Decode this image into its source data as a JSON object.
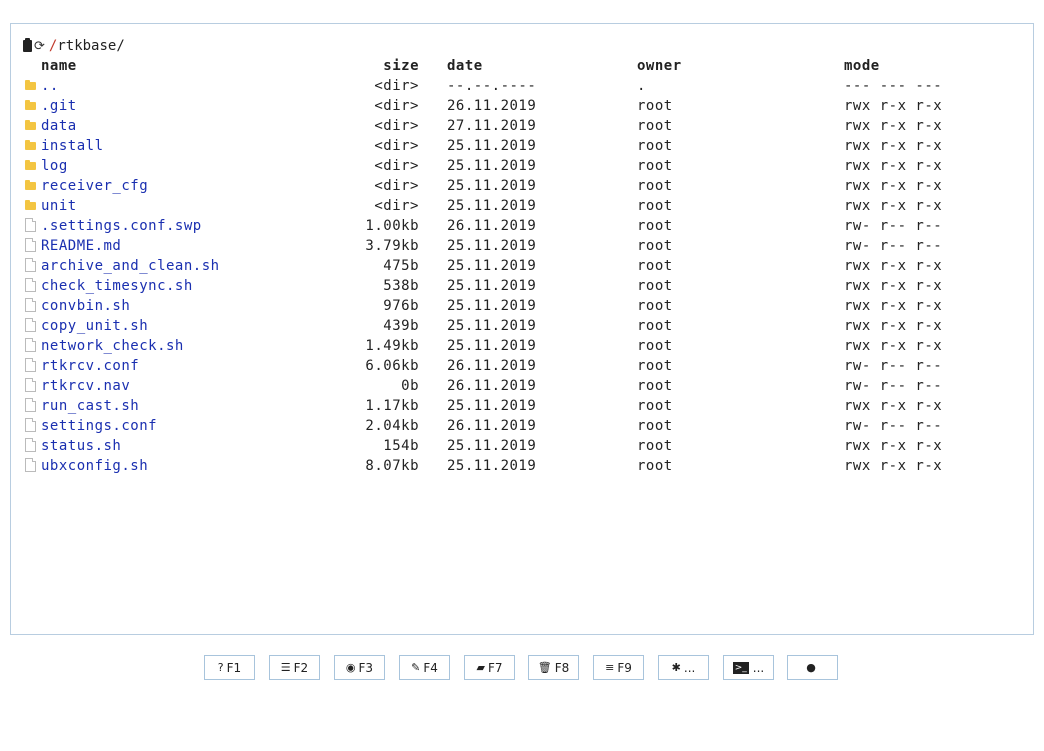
{
  "path": {
    "root": "/",
    "folder": "rtkbase/"
  },
  "columns": {
    "name": "name",
    "size": "size",
    "date": "date",
    "owner": "owner",
    "mode": "mode"
  },
  "files": [
    {
      "type": "dir",
      "name": "..",
      "size": "<dir>",
      "date": "--.--.----",
      "owner": ".",
      "mode": "--- --- ---"
    },
    {
      "type": "dir",
      "name": ".git",
      "size": "<dir>",
      "date": "26.11.2019",
      "owner": "root",
      "mode": "rwx r-x r-x"
    },
    {
      "type": "dir",
      "name": "data",
      "size": "<dir>",
      "date": "27.11.2019",
      "owner": "root",
      "mode": "rwx r-x r-x"
    },
    {
      "type": "dir",
      "name": "install",
      "size": "<dir>",
      "date": "25.11.2019",
      "owner": "root",
      "mode": "rwx r-x r-x"
    },
    {
      "type": "dir",
      "name": "log",
      "size": "<dir>",
      "date": "25.11.2019",
      "owner": "root",
      "mode": "rwx r-x r-x"
    },
    {
      "type": "dir",
      "name": "receiver_cfg",
      "size": "<dir>",
      "date": "25.11.2019",
      "owner": "root",
      "mode": "rwx r-x r-x"
    },
    {
      "type": "dir",
      "name": "unit",
      "size": "<dir>",
      "date": "25.11.2019",
      "owner": "root",
      "mode": "rwx r-x r-x"
    },
    {
      "type": "file",
      "name": ".settings.conf.swp",
      "size": "1.00kb",
      "date": "26.11.2019",
      "owner": "root",
      "mode": "rw- r-- r--"
    },
    {
      "type": "file",
      "name": "README.md",
      "size": "3.79kb",
      "date": "25.11.2019",
      "owner": "root",
      "mode": "rw- r-- r--"
    },
    {
      "type": "file",
      "name": "archive_and_clean.sh",
      "size": "475b",
      "date": "25.11.2019",
      "owner": "root",
      "mode": "rwx r-x r-x"
    },
    {
      "type": "file",
      "name": "check_timesync.sh",
      "size": "538b",
      "date": "25.11.2019",
      "owner": "root",
      "mode": "rwx r-x r-x"
    },
    {
      "type": "file",
      "name": "convbin.sh",
      "size": "976b",
      "date": "25.11.2019",
      "owner": "root",
      "mode": "rwx r-x r-x"
    },
    {
      "type": "file",
      "name": "copy_unit.sh",
      "size": "439b",
      "date": "25.11.2019",
      "owner": "root",
      "mode": "rwx r-x r-x"
    },
    {
      "type": "file",
      "name": "network_check.sh",
      "size": "1.49kb",
      "date": "25.11.2019",
      "owner": "root",
      "mode": "rwx r-x r-x"
    },
    {
      "type": "file",
      "name": "rtkrcv.conf",
      "size": "6.06kb",
      "date": "26.11.2019",
      "owner": "root",
      "mode": "rw- r-- r--"
    },
    {
      "type": "file",
      "name": "rtkrcv.nav",
      "size": "0b",
      "date": "26.11.2019",
      "owner": "root",
      "mode": "rw- r-- r--"
    },
    {
      "type": "file",
      "name": "run_cast.sh",
      "size": "1.17kb",
      "date": "25.11.2019",
      "owner": "root",
      "mode": "rwx r-x r-x"
    },
    {
      "type": "file",
      "name": "settings.conf",
      "size": "2.04kb",
      "date": "26.11.2019",
      "owner": "root",
      "mode": "rw- r-- r--"
    },
    {
      "type": "file",
      "name": "status.sh",
      "size": "154b",
      "date": "25.11.2019",
      "owner": "root",
      "mode": "rwx r-x r-x"
    },
    {
      "type": "file",
      "name": "ubxconfig.sh",
      "size": "8.07kb",
      "date": "25.11.2019",
      "owner": "root",
      "mode": "rwx r-x r-x"
    }
  ],
  "fkeys": [
    {
      "icon": "question-circle-icon",
      "glyph": "?",
      "label": "F1"
    },
    {
      "icon": "list-icon",
      "glyph": "☰",
      "label": "F2"
    },
    {
      "icon": "eye-icon",
      "glyph": "◉",
      "label": "F3"
    },
    {
      "icon": "edit-icon",
      "glyph": "✎",
      "label": "F4"
    },
    {
      "icon": "folder-open-icon",
      "glyph": "▰",
      "label": "F7"
    },
    {
      "icon": "trash-icon",
      "glyph": "🗑",
      "label": "F8"
    },
    {
      "icon": "menu-icon",
      "glyph": "≡",
      "label": "F9"
    },
    {
      "icon": "gear-icon",
      "glyph": "✱",
      "label": "..."
    },
    {
      "icon": "terminal-icon",
      "glyph": ">_",
      "label": "..."
    },
    {
      "icon": "comment-icon",
      "glyph": "●",
      "label": ""
    }
  ]
}
